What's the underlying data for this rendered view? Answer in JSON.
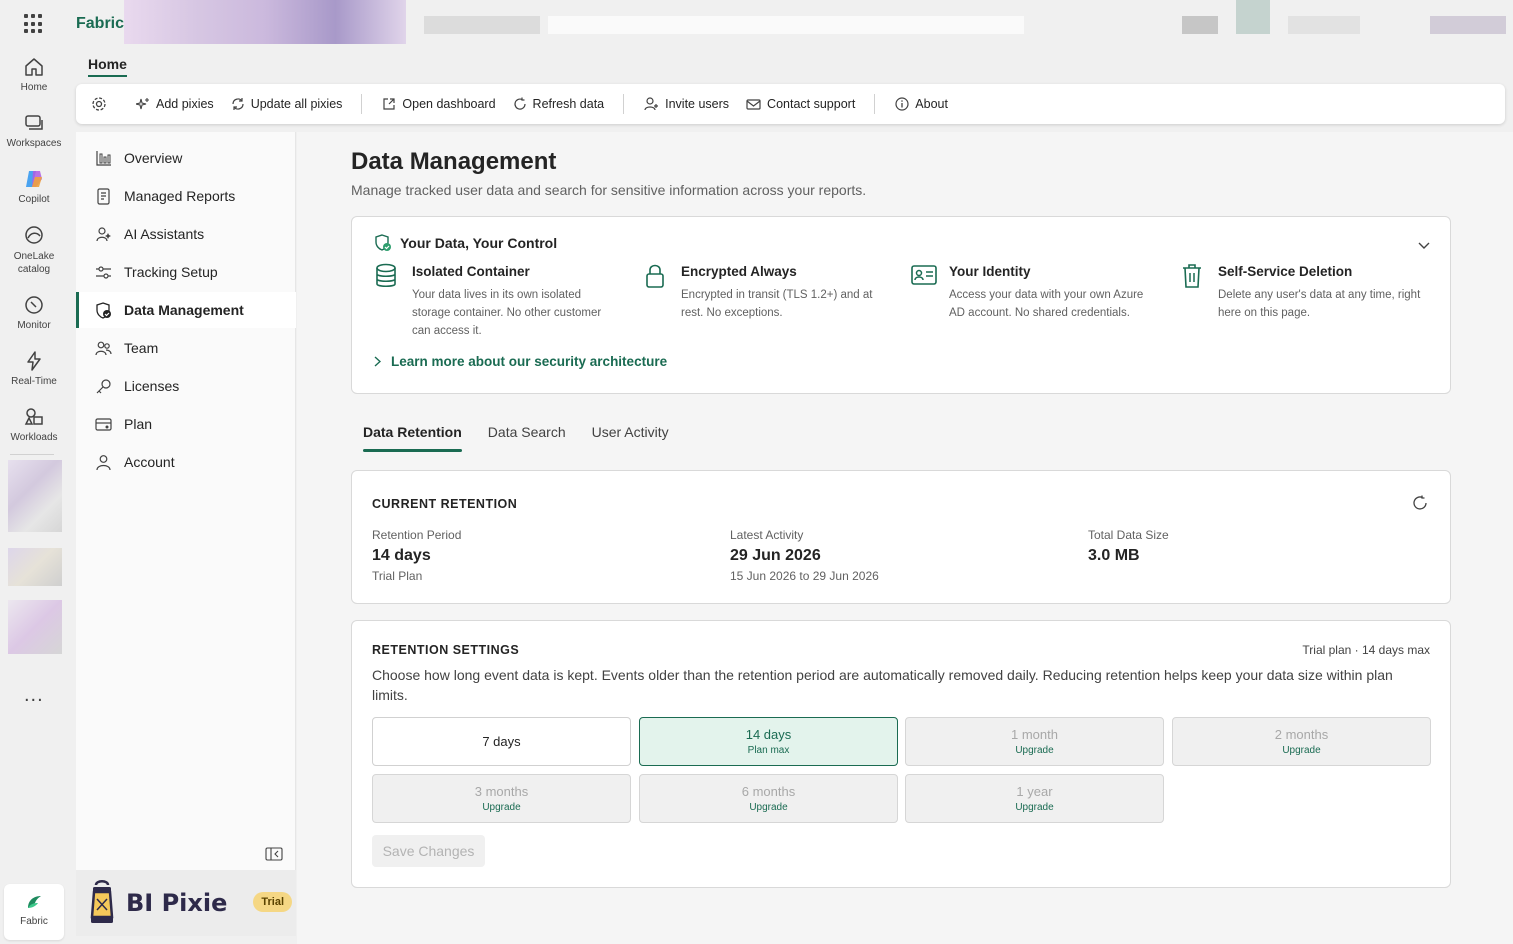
{
  "app": {
    "brand": "Fabric"
  },
  "colors": {
    "accent": "#1a6b52",
    "trial_badge": "#f5d784"
  },
  "rail": [
    {
      "label": "Home",
      "icon": "home-icon"
    },
    {
      "label": "Workspaces",
      "icon": "workspaces-icon"
    },
    {
      "label": "Copilot",
      "icon": "copilot-icon"
    },
    {
      "label": "OneLake catalog",
      "icon": "onelake-icon"
    },
    {
      "label": "Monitor",
      "icon": "monitor-icon"
    },
    {
      "label": "Real-Time",
      "icon": "lightning-icon"
    },
    {
      "label": "Workloads",
      "icon": "workloads-icon"
    }
  ],
  "rail_more": "...",
  "rail_fabric": "Fabric",
  "ribbon": {
    "home_tab": "Home",
    "buttons": {
      "add_pixies": "Add pixies",
      "update_all": "Update all pixies",
      "open_dashboard": "Open dashboard",
      "refresh_data": "Refresh data",
      "invite_users": "Invite users",
      "contact_support": "Contact support",
      "about": "About"
    }
  },
  "nav": {
    "items": [
      {
        "label": "Overview",
        "icon": "chart-bars-icon"
      },
      {
        "label": "Managed Reports",
        "icon": "report-icon"
      },
      {
        "label": "AI Assistants",
        "icon": "ai-assistant-icon"
      },
      {
        "label": "Tracking Setup",
        "icon": "sliders-icon"
      },
      {
        "label": "Data Management",
        "icon": "shield-check-icon",
        "active": true
      },
      {
        "label": "Team",
        "icon": "people-icon"
      },
      {
        "label": "Licenses",
        "icon": "key-icon"
      },
      {
        "label": "Plan",
        "icon": "plan-icon"
      },
      {
        "label": "Account",
        "icon": "person-icon"
      }
    ],
    "product_name": "BI Pixie",
    "badge": "Trial"
  },
  "page": {
    "title": "Data Management",
    "subtitle": "Manage tracked user data and search for sensitive information across your reports."
  },
  "security": {
    "heading": "Your Data, Your Control",
    "features": [
      {
        "title": "Isolated Container",
        "desc": "Your data lives in its own isolated storage container. No other customer can access it.",
        "icon": "database-icon"
      },
      {
        "title": "Encrypted Always",
        "desc": "Encrypted in transit (TLS 1.2+) and at rest. No exceptions.",
        "icon": "lock-icon"
      },
      {
        "title": "Your Identity",
        "desc": "Access your data with your own Azure AD account. No shared credentials.",
        "icon": "id-card-icon"
      },
      {
        "title": "Self-Service Deletion",
        "desc": "Delete any user's data at any time, right here on this page.",
        "icon": "trash-icon"
      }
    ],
    "learn_more": "Learn more about our security architecture"
  },
  "tabs": [
    "Data Retention",
    "Data Search",
    "User Activity"
  ],
  "current_retention": {
    "heading": "CURRENT RETENTION",
    "period_label": "Retention Period",
    "period_value": "14 days",
    "period_sub": "Trial Plan",
    "activity_label": "Latest Activity",
    "activity_value": "29 Jun 2026",
    "activity_sub": "15 Jun 2026 to 29 Jun 2026",
    "size_label": "Total Data Size",
    "size_value": "3.0 MB"
  },
  "retention_settings": {
    "heading": "RETENTION SETTINGS",
    "plan_note": "Trial plan · 14 days max",
    "description": "Choose how long event data is kept. Events older than the retention period are automatically removed daily. Reducing retention helps keep your data size within plan limits.",
    "options": [
      {
        "label": "7 days",
        "sub": "",
        "state": "available"
      },
      {
        "label": "14 days",
        "sub": "Plan max",
        "state": "selected"
      },
      {
        "label": "1 month",
        "sub": "Upgrade",
        "state": "disabled"
      },
      {
        "label": "2 months",
        "sub": "Upgrade",
        "state": "disabled"
      },
      {
        "label": "3 months",
        "sub": "Upgrade",
        "state": "disabled"
      },
      {
        "label": "6 months",
        "sub": "Upgrade",
        "state": "disabled"
      },
      {
        "label": "1 year",
        "sub": "Upgrade",
        "state": "disabled"
      }
    ],
    "save_label": "Save Changes"
  }
}
